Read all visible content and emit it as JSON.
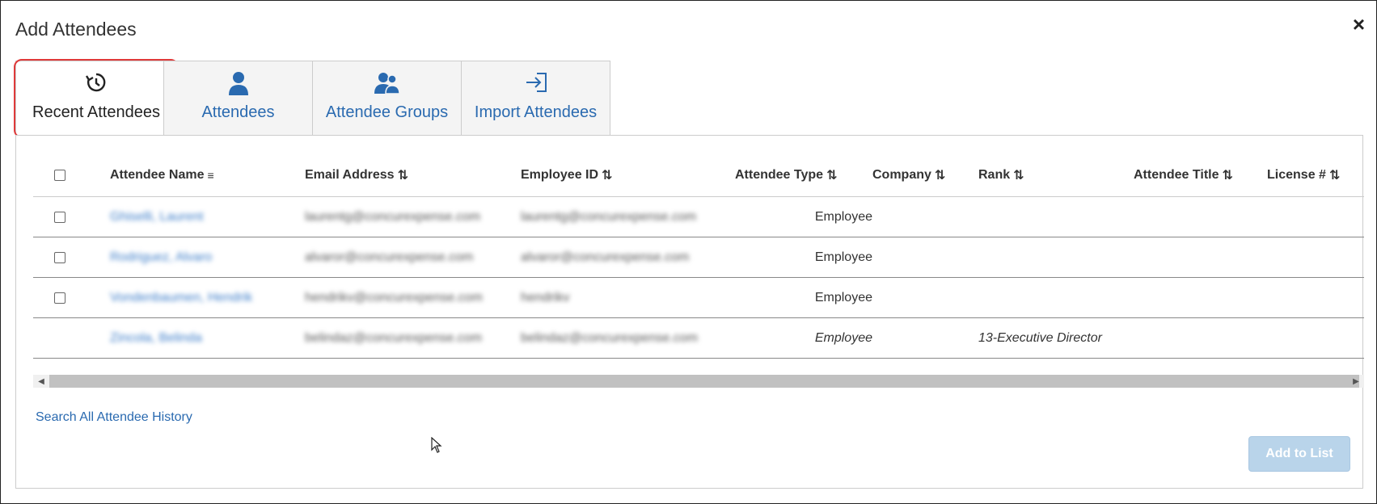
{
  "dialog": {
    "title": "Add Attendees",
    "close_label": "×"
  },
  "tabs": [
    {
      "label": "Recent Attendees",
      "icon": "history-icon",
      "active": true
    },
    {
      "label": "Attendees",
      "icon": "person-icon",
      "active": false
    },
    {
      "label": "Attendee Groups",
      "icon": "group-icon",
      "active": false
    },
    {
      "label": "Import Attendees",
      "icon": "import-icon",
      "active": false
    }
  ],
  "table": {
    "columns": {
      "name": "Attendee Name",
      "email": "Email Address",
      "employee_id": "Employee ID",
      "type": "Attendee Type",
      "company": "Company",
      "rank": "Rank",
      "title": "Attendee Title",
      "license": "License #"
    },
    "sort_icon": "⇅",
    "sorted_icon": "≡",
    "rows": [
      {
        "name": "Ghiselli, Laurent",
        "email": "laurentg@concurexpense.com",
        "employee_id": "laurentg@concurexpense.com",
        "type": "Employee",
        "rank": "",
        "checkbox": true,
        "italic": false
      },
      {
        "name": "Rodriguez, Alvaro",
        "email": "alvaror@concurexpense.com",
        "employee_id": "alvaror@concurexpense.com",
        "type": "Employee",
        "rank": "",
        "checkbox": true,
        "italic": false
      },
      {
        "name": "Vondenbaumen, Hendrik",
        "email": "hendrikv@concurexpense.com",
        "employee_id": "hendrikv",
        "type": "Employee",
        "rank": "",
        "checkbox": true,
        "italic": false
      },
      {
        "name": "Zincola, Belinda",
        "email": "belindaz@concurexpense.com",
        "employee_id": "belindaz@concurexpense.com",
        "type": "Employee",
        "rank": "13-Executive Director",
        "checkbox": false,
        "italic": true
      }
    ]
  },
  "footer": {
    "search_link": "Search All Attendee History",
    "add_button": "Add to List"
  }
}
